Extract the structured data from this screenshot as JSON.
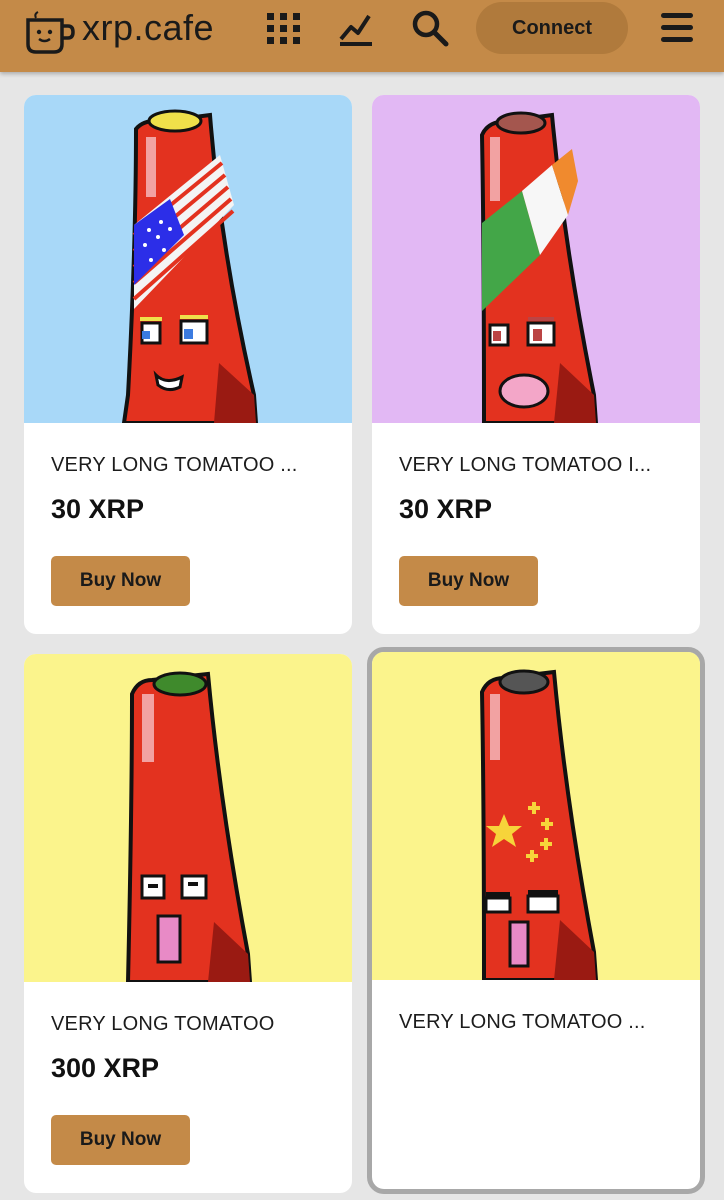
{
  "header": {
    "brand": "xrp.cafe",
    "connect_label": "Connect",
    "icons": [
      "coffee-cup-logo-icon",
      "grid-icon",
      "chart-icon",
      "search-icon",
      "menu-icon"
    ],
    "colors": {
      "bar": "#c48a48",
      "connect": "#b07a3c"
    }
  },
  "cards": [
    {
      "title": "VERY LONG TOMATOO ...",
      "price": "30 XRP",
      "buy_label": "Buy Now",
      "background": "#a8d8f8"
    },
    {
      "title": "VERY LONG TOMATOO I...",
      "price": "30 XRP",
      "buy_label": "Buy Now",
      "background": "#e2b8f4"
    },
    {
      "title": "VERY LONG TOMATOO",
      "price": "300 XRP",
      "buy_label": "Buy Now",
      "background": "#fbf48c"
    },
    {
      "title": "VERY LONG TOMATOO ...",
      "background": "#fbf48c"
    }
  ]
}
